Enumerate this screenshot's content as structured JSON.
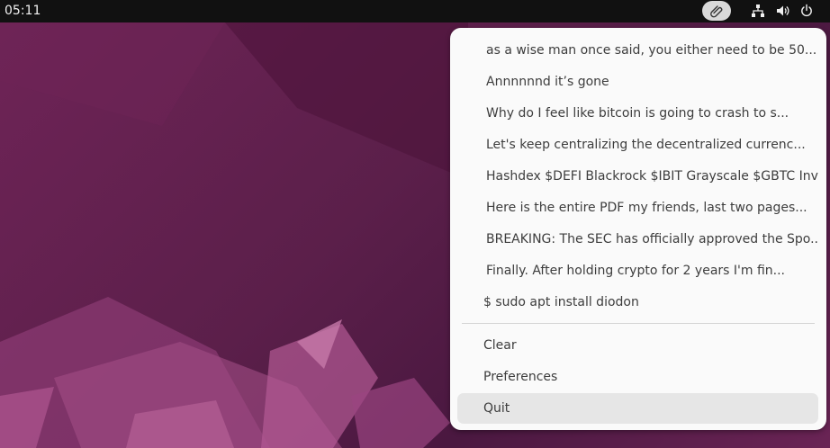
{
  "topbar": {
    "clock": "05:11",
    "icons": [
      "clipboard-icon",
      "network-icon",
      "volume-icon",
      "power-icon"
    ]
  },
  "menu": {
    "history": [
      "as a wise man once said, you either need to be 50...",
      "Annnnnnd it’s gone",
      "Why do I feel like bitcoin is going to crash to s...",
      "Let's keep centralizing the decentralized currenc...",
      "Hashdex $DEFI Blackrock $IBIT Grayscale $GBTC Inv...",
      "Here is the entire PDF my friends, last two pages...",
      "BREAKING: The SEC has officially approved the Spo...",
      "Finally. After holding crypto for 2 years I'm fin...",
      "$ sudo apt install diodon"
    ],
    "actions": [
      "Clear",
      "Preferences",
      "Quit"
    ]
  },
  "colors": {
    "topbar": "#111111",
    "menu_bg": "#fafafa",
    "menu_text": "#3d3d3d",
    "hover": "#e6e6e6",
    "wallpaper": "#5b1f4a"
  }
}
